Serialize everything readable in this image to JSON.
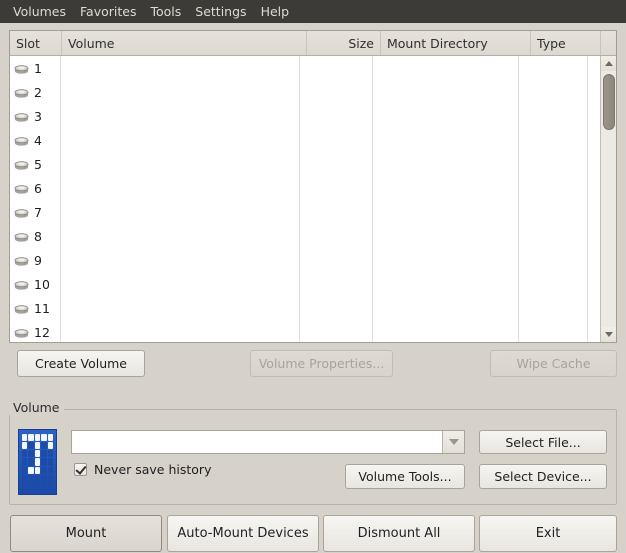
{
  "menubar": {
    "items": [
      {
        "label": "Volumes"
      },
      {
        "label": "Favorites"
      },
      {
        "label": "Tools"
      },
      {
        "label": "Settings"
      },
      {
        "label": "Help"
      }
    ]
  },
  "volume_list": {
    "columns": [
      {
        "key": "slot",
        "label": "Slot"
      },
      {
        "key": "volume",
        "label": "Volume"
      },
      {
        "key": "size",
        "label": "Size"
      },
      {
        "key": "mount",
        "label": "Mount Directory"
      },
      {
        "key": "type",
        "label": "Type"
      },
      {
        "key": "end",
        "label": ""
      }
    ],
    "rows": [
      {
        "slot": "1",
        "volume": "",
        "size": "",
        "mount": "",
        "type": ""
      },
      {
        "slot": "2",
        "volume": "",
        "size": "",
        "mount": "",
        "type": ""
      },
      {
        "slot": "3",
        "volume": "",
        "size": "",
        "mount": "",
        "type": ""
      },
      {
        "slot": "4",
        "volume": "",
        "size": "",
        "mount": "",
        "type": ""
      },
      {
        "slot": "5",
        "volume": "",
        "size": "",
        "mount": "",
        "type": ""
      },
      {
        "slot": "6",
        "volume": "",
        "size": "",
        "mount": "",
        "type": ""
      },
      {
        "slot": "7",
        "volume": "",
        "size": "",
        "mount": "",
        "type": ""
      },
      {
        "slot": "8",
        "volume": "",
        "size": "",
        "mount": "",
        "type": ""
      },
      {
        "slot": "9",
        "volume": "",
        "size": "",
        "mount": "",
        "type": ""
      },
      {
        "slot": "10",
        "volume": "",
        "size": "",
        "mount": "",
        "type": ""
      },
      {
        "slot": "11",
        "volume": "",
        "size": "",
        "mount": "",
        "type": ""
      },
      {
        "slot": "12",
        "volume": "",
        "size": "",
        "mount": "",
        "type": ""
      }
    ],
    "row_icon": "drive-icon",
    "scrollbar": {
      "up_icon": "scroll-up-arrow-icon",
      "down_icon": "scroll-down-arrow-icon"
    }
  },
  "actions": {
    "create_volume": {
      "label": "Create Volume",
      "enabled": true
    },
    "volume_properties": {
      "label": "Volume Properties...",
      "enabled": false
    },
    "wipe_cache": {
      "label": "Wipe Cache",
      "enabled": false
    }
  },
  "volume_group": {
    "title": "Volume",
    "logo_icon": "veracrypt-logo-icon",
    "path_combo": {
      "value": "",
      "placeholder": "",
      "arrow_icon": "chevron-down-icon"
    },
    "never_save_history": {
      "label": "Never save history",
      "checked": true
    },
    "select_file": {
      "label": "Select File..."
    },
    "volume_tools": {
      "label": "Volume Tools..."
    },
    "select_device": {
      "label": "Select Device..."
    }
  },
  "bottom_actions": {
    "mount": {
      "label": "Mount",
      "focused": true
    },
    "auto_mount": {
      "label": "Auto-Mount Devices"
    },
    "dismount_all": {
      "label": "Dismount All"
    },
    "exit": {
      "label": "Exit"
    }
  },
  "colors": {
    "menubar_bg": "#3c3b37",
    "window_bg": "#d6d2ca",
    "list_bg": "#ffffff",
    "logo_blue": "#1c4ba9",
    "accent_text": "#dfdbd2"
  }
}
